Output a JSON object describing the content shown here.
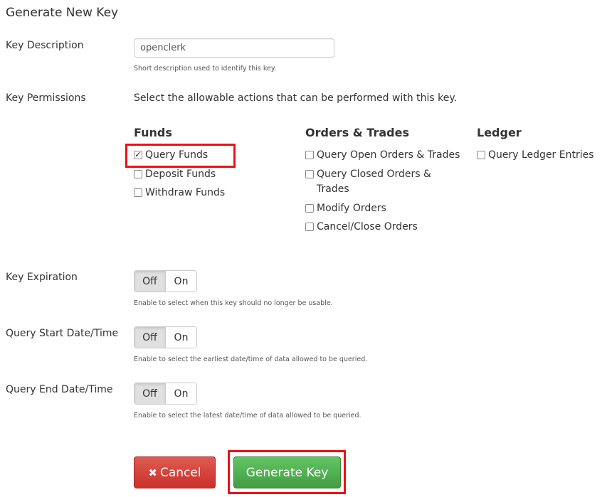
{
  "page": {
    "title": "Generate New Key"
  },
  "description": {
    "label": "Key Description",
    "value": "openclerk",
    "help": "Short description used to identify this key."
  },
  "permissions": {
    "label": "Key Permissions",
    "intro": "Select the allowable actions that can be performed with this key.",
    "groups": [
      {
        "title": "Funds",
        "items": [
          {
            "label": "Query Funds",
            "checked": true
          },
          {
            "label": "Deposit Funds",
            "checked": false
          },
          {
            "label": "Withdraw Funds",
            "checked": false
          }
        ]
      },
      {
        "title": "Orders & Trades",
        "items": [
          {
            "label": "Query Open Orders & Trades",
            "checked": false
          },
          {
            "label": "Query Closed Orders & Trades",
            "checked": false
          },
          {
            "label": "Modify Orders",
            "checked": false
          },
          {
            "label": "Cancel/Close Orders",
            "checked": false
          }
        ]
      },
      {
        "title": "Ledger",
        "items": [
          {
            "label": "Query Ledger Entries",
            "checked": false
          }
        ]
      }
    ]
  },
  "expiration": {
    "label": "Key Expiration",
    "off": "Off",
    "on": "On",
    "selected": "Off",
    "help": "Enable to select when this key should no longer be usable."
  },
  "start": {
    "label": "Query Start Date/Time",
    "off": "Off",
    "on": "On",
    "selected": "Off",
    "help": "Enable to select the earliest date/time of data allowed to be queried."
  },
  "end": {
    "label": "Query End Date/Time",
    "off": "Off",
    "on": "On",
    "selected": "Off",
    "help": "Enable to select the latest date/time of data allowed to be queried."
  },
  "buttons": {
    "cancel": "Cancel",
    "cancel_icon": "close-icon",
    "generate": "Generate Key"
  }
}
